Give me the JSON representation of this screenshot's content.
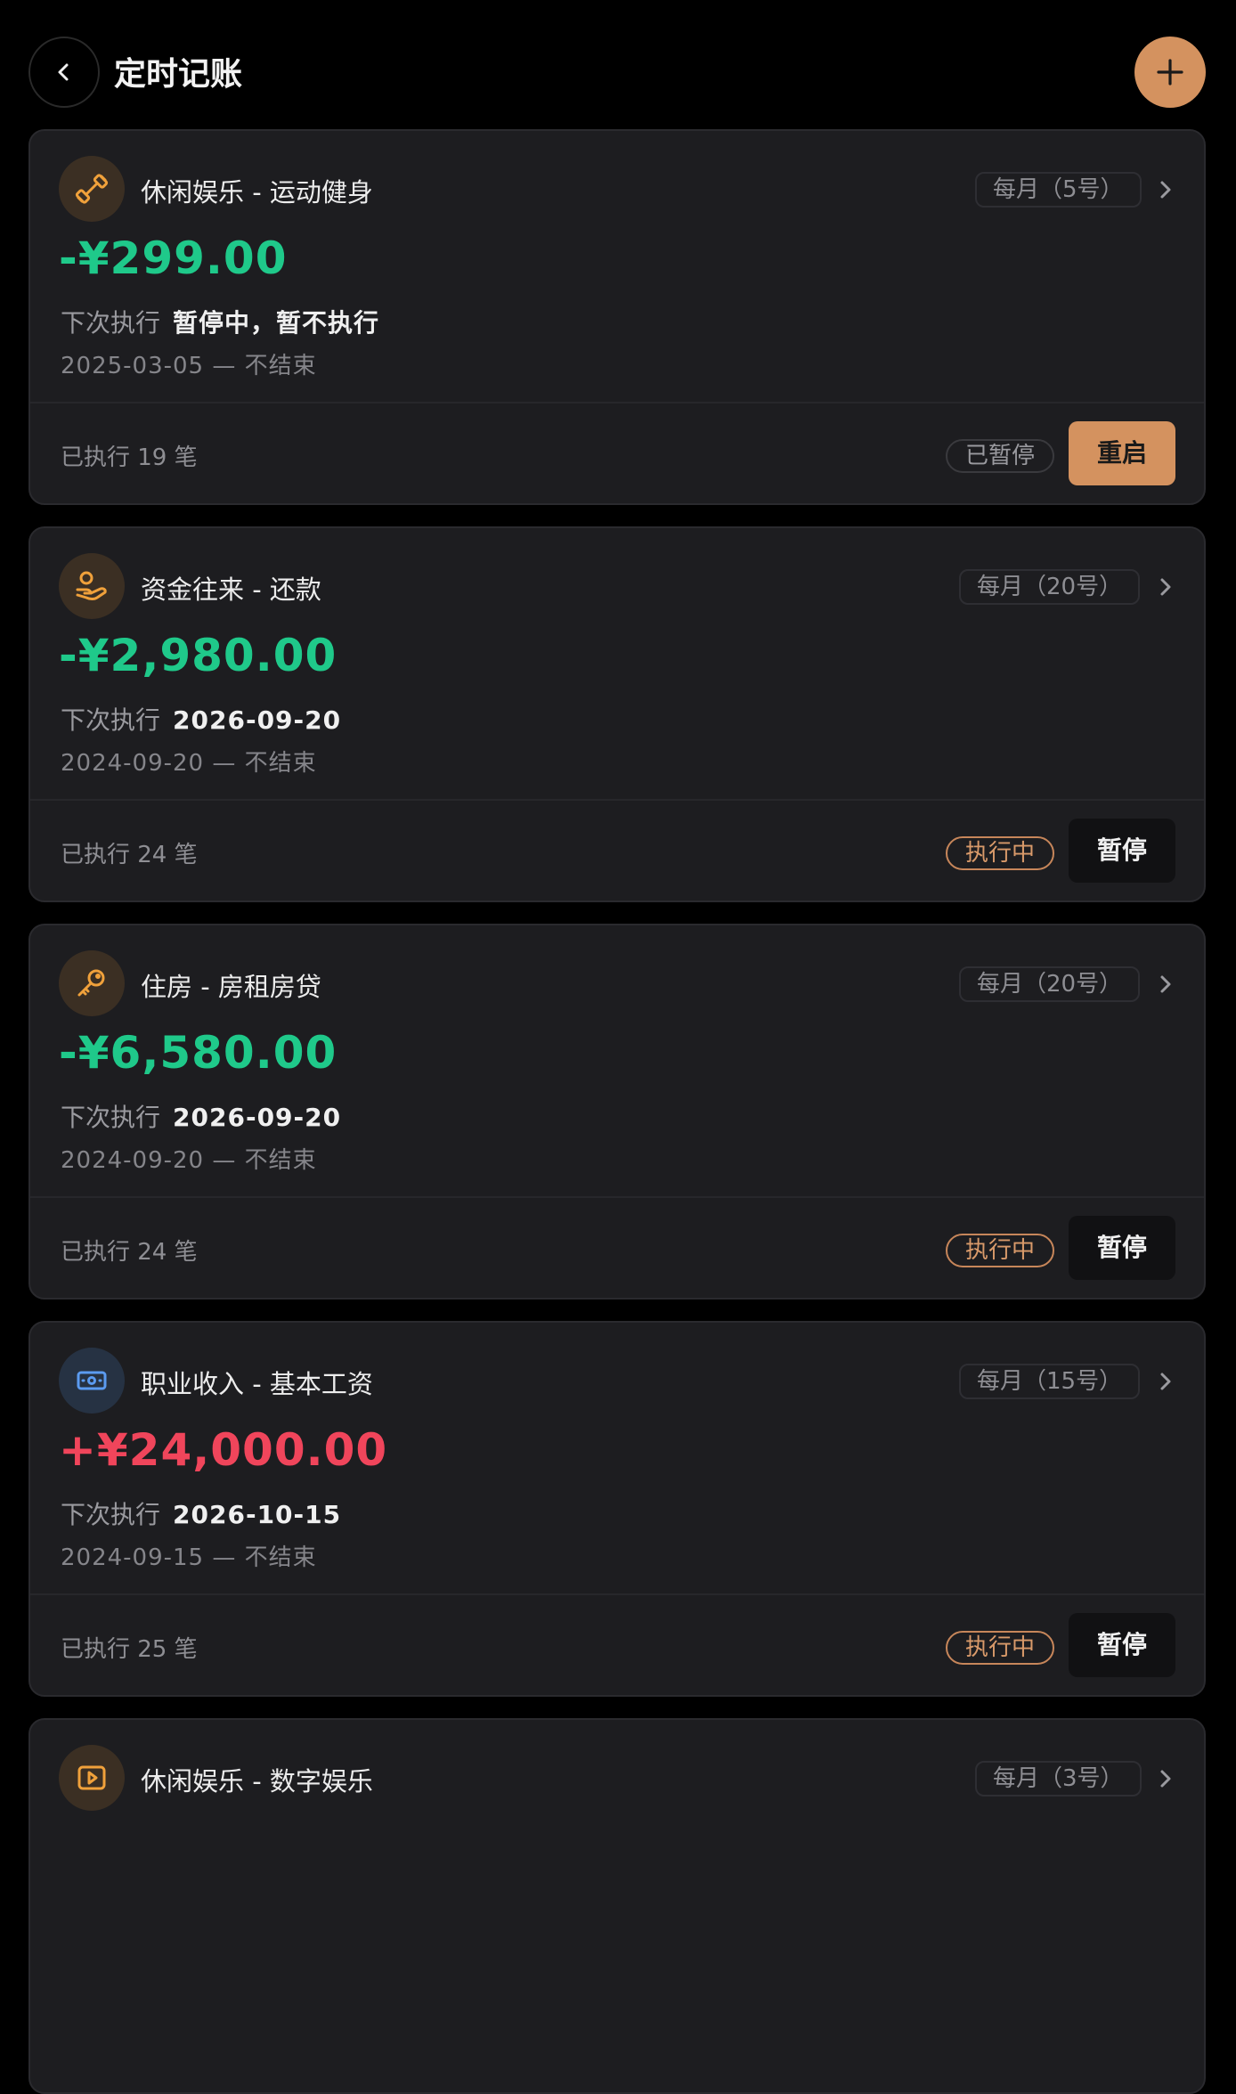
{
  "header": {
    "title": "定时记账"
  },
  "next_label": "下次执行",
  "cards": [
    {
      "category": "休闲娱乐 - 运动健身",
      "icon": "dumbbell-icon",
      "frequency": "每月（5号）",
      "amount": "-¥299.00",
      "type": "expense",
      "next_value": "暂停中，暂不执行",
      "range": "2025-03-05 — 不结束",
      "executed": "已执行 19 笔",
      "status": "已暂停",
      "action": "重启"
    },
    {
      "category": "资金往来 - 还款",
      "icon": "hand-money-icon",
      "frequency": "每月（20号）",
      "amount": "-¥2,980.00",
      "type": "expense",
      "next_value": "2026-09-20",
      "range": "2024-09-20 — 不结束",
      "executed": "已执行 24 笔",
      "status": "执行中",
      "action": "暂停"
    },
    {
      "category": "住房 - 房租房贷",
      "icon": "key-icon",
      "frequency": "每月（20号）",
      "amount": "-¥6,580.00",
      "type": "expense",
      "next_value": "2026-09-20",
      "range": "2024-09-20 — 不结束",
      "executed": "已执行 24 笔",
      "status": "执行中",
      "action": "暂停"
    },
    {
      "category": "职业收入 - 基本工资",
      "icon": "cash-icon",
      "frequency": "每月（15号）",
      "amount": "+¥24,000.00",
      "type": "income",
      "next_value": "2026-10-15",
      "range": "2024-09-15 — 不结束",
      "executed": "已执行 25 笔",
      "status": "执行中",
      "action": "暂停"
    },
    {
      "category": "休闲娱乐 - 数字娱乐",
      "icon": "play-icon",
      "frequency": "每月（3号）"
    }
  ],
  "colors": {
    "accent": "#d4925f",
    "expense": "#1fc98a",
    "income": "#f0455b",
    "card": "#1d1d20"
  }
}
